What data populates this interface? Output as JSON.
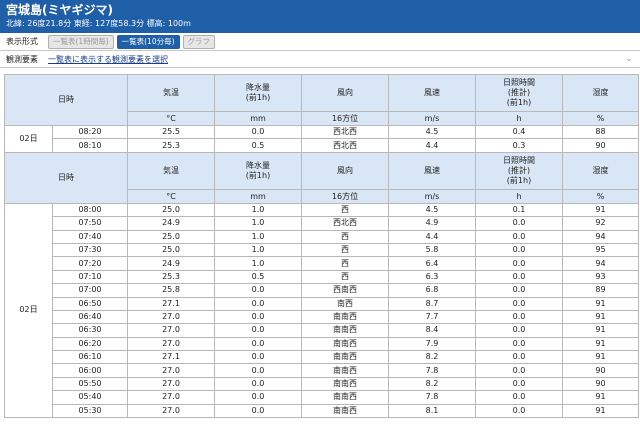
{
  "header": {
    "title": "宮城島(ミヤギジマ)",
    "location": "北緯: 26度21.8分 東経: 127度58.3分 標高: 100m"
  },
  "display_format": {
    "label": "表示形式",
    "buttons": [
      "一覧表(1時間毎)",
      "一覧表(10分毎)",
      "グラフ"
    ],
    "active": "一覧表(10分毎)"
  },
  "elements": {
    "label": "観測要素",
    "link": "一覧表に表示する観測要素を選択"
  },
  "table": {
    "headers": [
      "日時",
      "気温",
      "降水量\n(前1h)",
      "風向",
      "風速",
      "日照時間\n(推計)\n(前1h)",
      "湿度"
    ],
    "units": [
      "°C",
      "mm",
      "16方位",
      "m/s",
      "h",
      "%"
    ],
    "top_day": "02日",
    "top_rows": [
      [
        "08:20",
        "25.5",
        "0.0",
        "西北西",
        "4.5",
        "0.4",
        "88"
      ],
      [
        "08:10",
        "25.3",
        "0.5",
        "西北西",
        "4.4",
        "0.3",
        "90"
      ]
    ],
    "main_day": "02日",
    "rows": [
      [
        "08:00",
        "25.0",
        "1.0",
        "西",
        "4.5",
        "0.1",
        "91"
      ],
      [
        "07:50",
        "24.9",
        "1.0",
        "西北西",
        "4.9",
        "0.0",
        "92"
      ],
      [
        "07:40",
        "25.0",
        "1.0",
        "西",
        "4.4",
        "0.0",
        "94"
      ],
      [
        "07:30",
        "25.0",
        "1.0",
        "西",
        "5.8",
        "0.0",
        "95"
      ],
      [
        "07:20",
        "24.9",
        "1.0",
        "西",
        "6.4",
        "0.0",
        "94"
      ],
      [
        "07:10",
        "25.3",
        "0.5",
        "西",
        "6.3",
        "0.0",
        "93"
      ],
      [
        "07:00",
        "25.8",
        "0.0",
        "西南西",
        "6.8",
        "0.0",
        "89"
      ],
      [
        "06:50",
        "27.1",
        "0.0",
        "南西",
        "8.7",
        "0.0",
        "91"
      ],
      [
        "06:40",
        "27.0",
        "0.0",
        "南南西",
        "7.7",
        "0.0",
        "91"
      ],
      [
        "06:30",
        "27.0",
        "0.0",
        "南南西",
        "8.4",
        "0.0",
        "91"
      ],
      [
        "06:20",
        "27.0",
        "0.0",
        "南南西",
        "7.9",
        "0.0",
        "91"
      ],
      [
        "06:10",
        "27.1",
        "0.0",
        "南南西",
        "8.2",
        "0.0",
        "91"
      ],
      [
        "06:00",
        "27.0",
        "0.0",
        "南南西",
        "7.8",
        "0.0",
        "90"
      ],
      [
        "05:50",
        "27.0",
        "0.0",
        "南南西",
        "8.2",
        "0.0",
        "90"
      ],
      [
        "05:40",
        "27.0",
        "0.0",
        "南南西",
        "7.8",
        "0.0",
        "91"
      ],
      [
        "05:30",
        "27.0",
        "0.0",
        "南南西",
        "8.1",
        "0.0",
        "91"
      ]
    ]
  }
}
